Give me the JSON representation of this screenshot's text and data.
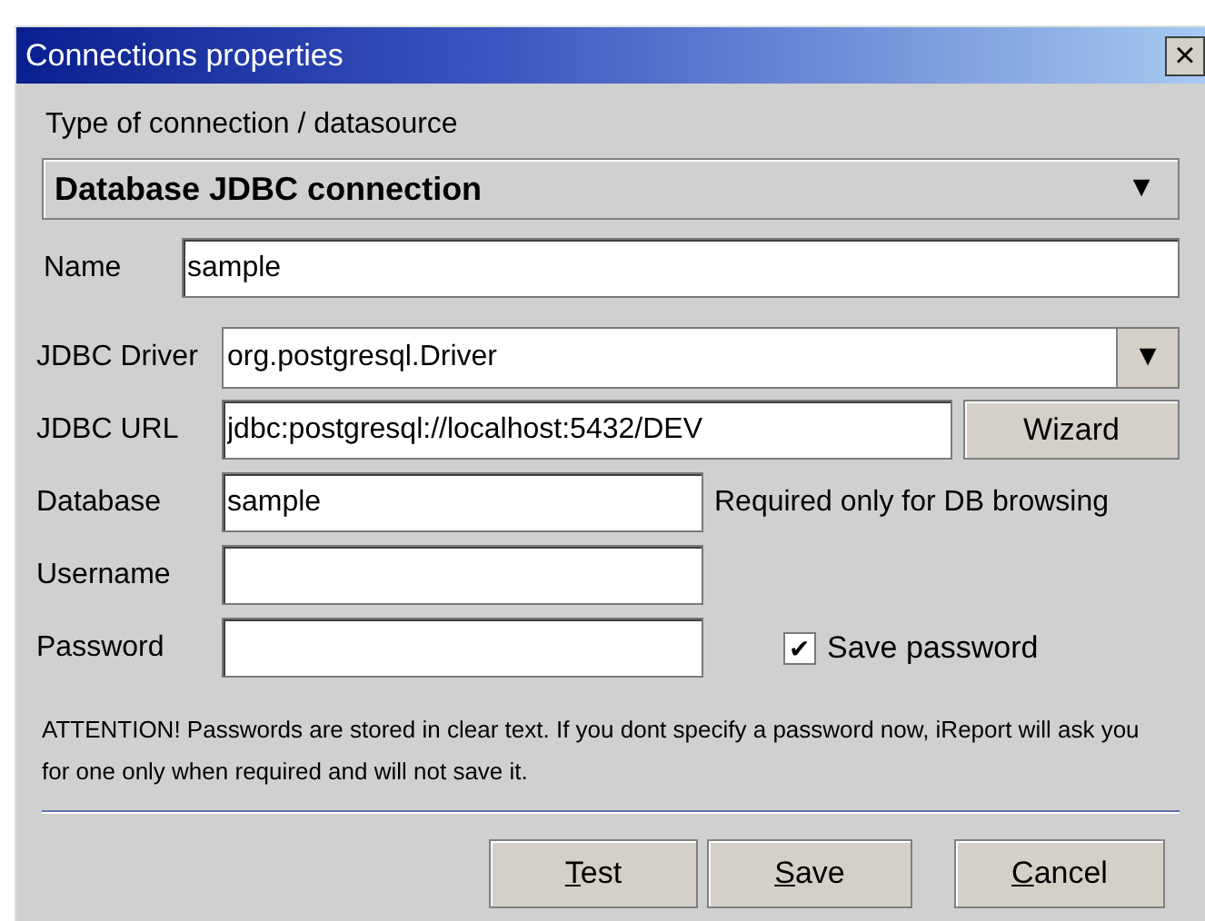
{
  "window": {
    "title": "Connections properties",
    "close": "×"
  },
  "type_label": "Type of connection / datasource",
  "type_combo": {
    "value": "Database JDBC connection",
    "arrow": "▼"
  },
  "name": {
    "label": "Name",
    "value": "sample"
  },
  "driver": {
    "label": "JDBC Driver",
    "value": "org.postgresql.Driver",
    "arrow": "▼"
  },
  "url": {
    "label": "JDBC URL",
    "value": "jdbc:postgresql://localhost:5432/DEV",
    "button": "Wizard"
  },
  "database": {
    "label": "Database",
    "value": "sample",
    "note": "Required only for DB browsing"
  },
  "username": {
    "label": "Username"
  },
  "password": {
    "label": "Password"
  },
  "save_password": {
    "label": "Save password",
    "checked": true,
    "mark": "✔"
  },
  "attention": "ATTENTION! Passwords are stored in clear text. If you dont specify a password now, iReport will ask you for one only when required and will not save it.",
  "buttons": [
    "Test",
    "Save",
    "Cancel"
  ]
}
